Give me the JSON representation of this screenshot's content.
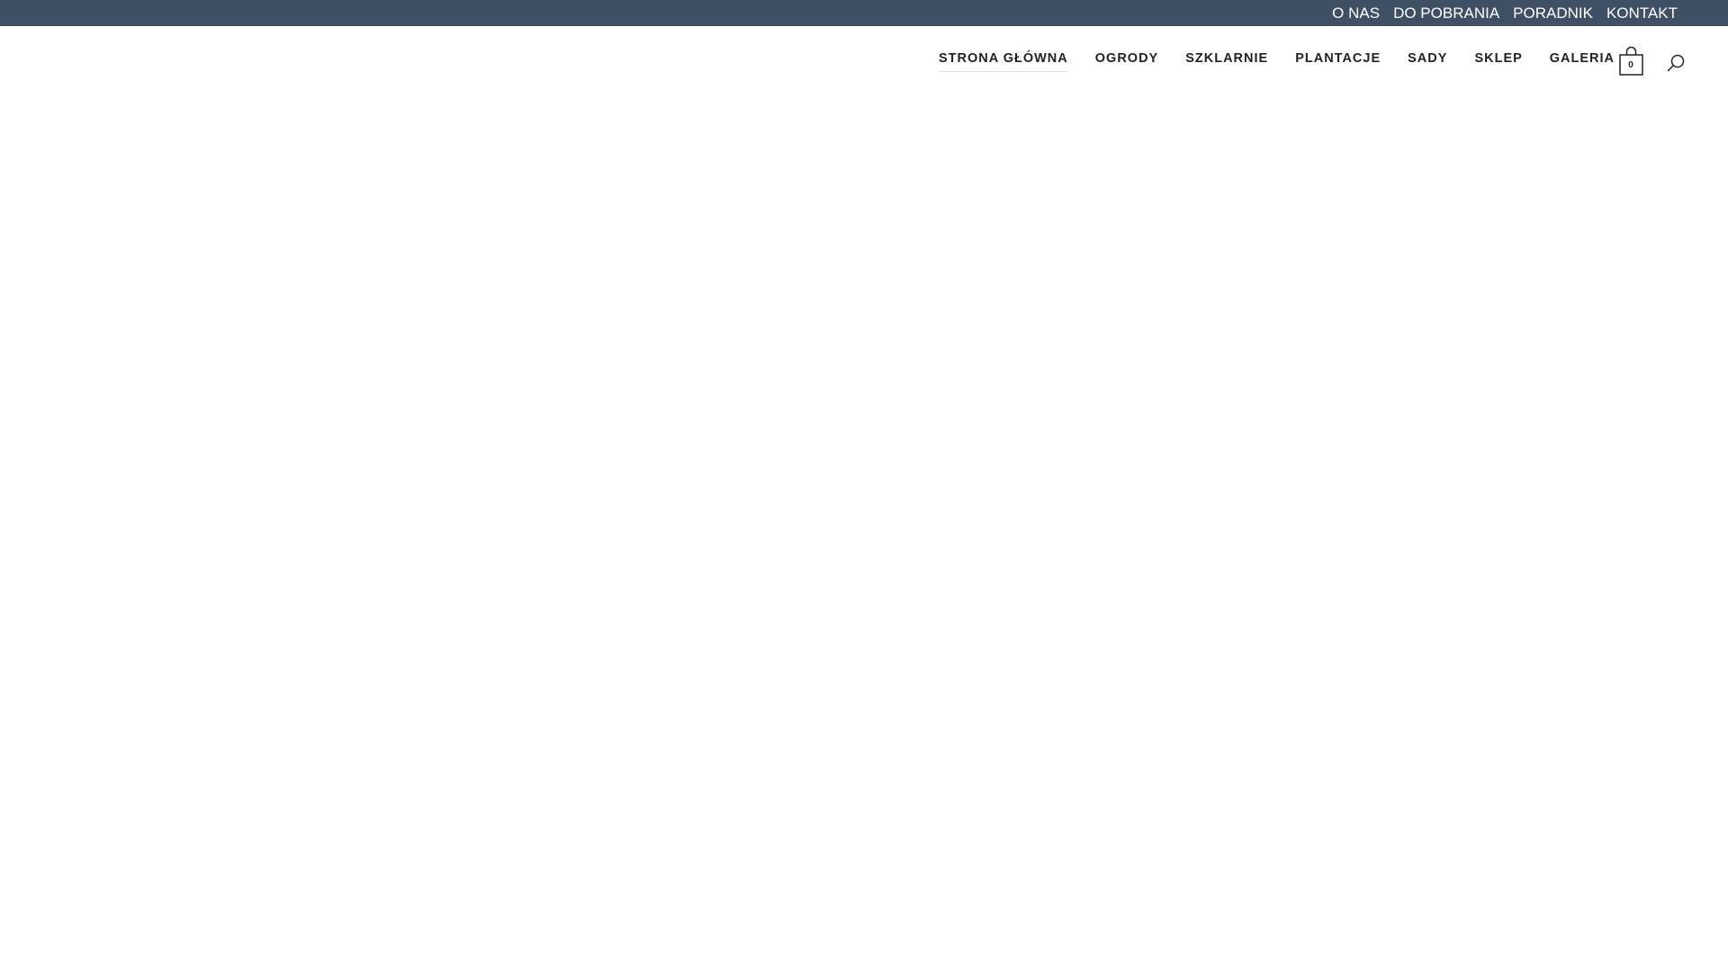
{
  "topbar": {
    "links": [
      "O NAS",
      "DO POBRANIA",
      "PORADNIK",
      "KONTAKT"
    ],
    "background": "#3e5063"
  },
  "nav": {
    "items": [
      "STRONA GŁÓWNA",
      "OGRODY",
      "SZKLARNIE",
      "PLANTACJE",
      "SADY",
      "SKLEP",
      "GALERIA"
    ],
    "active_index": 0
  },
  "cart": {
    "icon": "shopping-bag-icon",
    "count": "0"
  },
  "search": {
    "icon": "search-icon"
  }
}
